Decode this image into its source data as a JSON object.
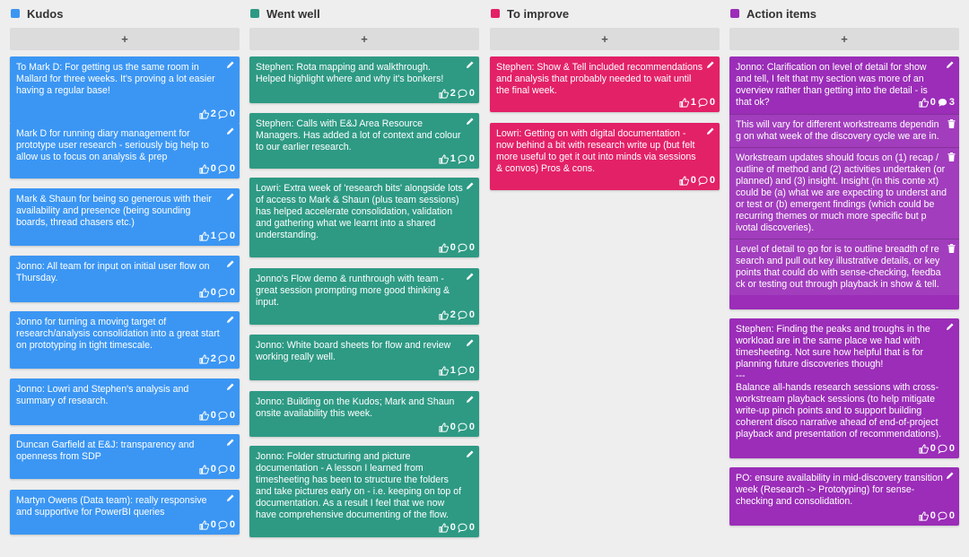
{
  "columns": [
    {
      "key": "kudos",
      "title": "Kudos",
      "color": "#3b96f3",
      "add_label": "+",
      "cards": [
        {
          "text": "To Mark D: For getting us the same room in Mallard for three weeks. It's proving a lot easier having a regular base!",
          "likes": "2",
          "comments": "0"
        },
        {
          "text": "Mark D for running diary management for prototype user research - seriously big help to allow us to focus on analysis & prep",
          "likes": "0",
          "comments": "0"
        },
        {
          "text": "Mark & Shaun for being so generous with their availability and presence (being sounding boards, thread chasers etc.)",
          "likes": "1",
          "comments": "0"
        },
        {
          "text": "Jonno: All team for input on initial user flow on Thursday.",
          "likes": "0",
          "comments": "0"
        },
        {
          "text": "Jonno for turning a moving target of research/analysis consolidation into a great start on prototyping in tight timescale.",
          "likes": "2",
          "comments": "0"
        },
        {
          "text": "Jonno: Lowri and Stephen's analysis and summary of research.",
          "likes": "0",
          "comments": "0"
        },
        {
          "text": "Duncan Garfield at E&J: transparency and openness from SDP",
          "likes": "0",
          "comments": "0"
        },
        {
          "text": "Martyn Owens (Data team): really responsive and supportive for PowerBI queries",
          "likes": "0",
          "comments": "0"
        }
      ]
    },
    {
      "key": "wentwell",
      "title": "Went well",
      "color": "#2e9a84",
      "add_label": "+",
      "cards": [
        {
          "text": "Stephen: Rota mapping and walkthrough. Helped highlight where and why it's bonkers!",
          "likes": "2",
          "comments": "0"
        },
        {
          "text": "Stephen: Calls with E&J Area Resource Managers. Has added a lot of context and colour to our earlier research.",
          "likes": "1",
          "comments": "0"
        },
        {
          "text": "Lowri: Extra week of 'research bits' alongside lots of access to Mark & Shaun (plus team sessions) has helped accelerate consolidation, validation and gathering what we learnt into a shared understanding.",
          "likes": "0",
          "comments": "0"
        },
        {
          "text": "Jonno's Flow demo & runthrough with team - great session prompting more good thinking & input.",
          "likes": "2",
          "comments": "0"
        },
        {
          "text": "Jonno: White board sheets for flow and review working really well.",
          "likes": "1",
          "comments": "0"
        },
        {
          "text": "Jonno: Building on the Kudos; Mark and Shaun onsite availability this week.",
          "likes": "0",
          "comments": "0"
        },
        {
          "text": "Jonno: Folder structuring and picture documentation - A lesson I learned from timesheeting has been to structure the folders and take pictures early on - i.e. keeping on top of documentation. As a result I feel that we now have comprehensive documenting of the flow.",
          "likes": "0",
          "comments": "0"
        }
      ]
    },
    {
      "key": "improve",
      "title": "To improve",
      "color": "#e32167",
      "add_label": "+",
      "cards": [
        {
          "text": "Stephen: Show & Tell included recommendations and analysis that probably needed to wait until the final week.",
          "likes": "1",
          "comments": "0"
        },
        {
          "text": "Lowri: Getting on with digital documentation - now behind a bit with research write up (but felt more useful to get it out into minds via sessions & convos) Pros & cons.",
          "likes": "0",
          "comments": "0"
        }
      ]
    },
    {
      "key": "actions",
      "title": "Action items",
      "color": "#9b2db8",
      "add_label": "+",
      "cards": [
        {
          "text": "Jonno: Clarification on level of detail for show and tell, I felt that my section was more of an overview rather than getting into the detail - is that ok?",
          "likes": "0",
          "comments": "3",
          "replies": [
            "This will vary for different workstreams dependin g on what week of the discovery cycle we are in.",
            "Workstream updates should focus on (1) recap / outline of method and (2) activities undertaken (or planned) and (3) insight. Insight (in this conte xt) could be (a) what we are expecting to underst and or test or (b) emergent findings (which could be recurring themes or much more specific but p ivotal discoveries).",
            "Level of detail to go for is to outline breadth of re search and pull out key illustrative details, or key points that could do with sense-checking, feedba ck or testing out through playback in show & tell."
          ]
        },
        {
          "text": "Stephen: Finding the peaks and troughs in the workload are in the same place we had with timesheeting. Not sure how helpful that is for planning future discoveries though!\n---\nBalance all-hands research sessions with cross-workstream playback sessions (to help mitigate write-up pinch points and to support building coherent disco narrative ahead of end-of-project playback and presentation of recommendations).",
          "likes": "0",
          "comments": "0"
        },
        {
          "text": "PO: ensure availability in mid-discovery transition week (Research -> Prototyping) for sense-checking and consolidation.",
          "likes": "0",
          "comments": "0"
        }
      ]
    }
  ]
}
